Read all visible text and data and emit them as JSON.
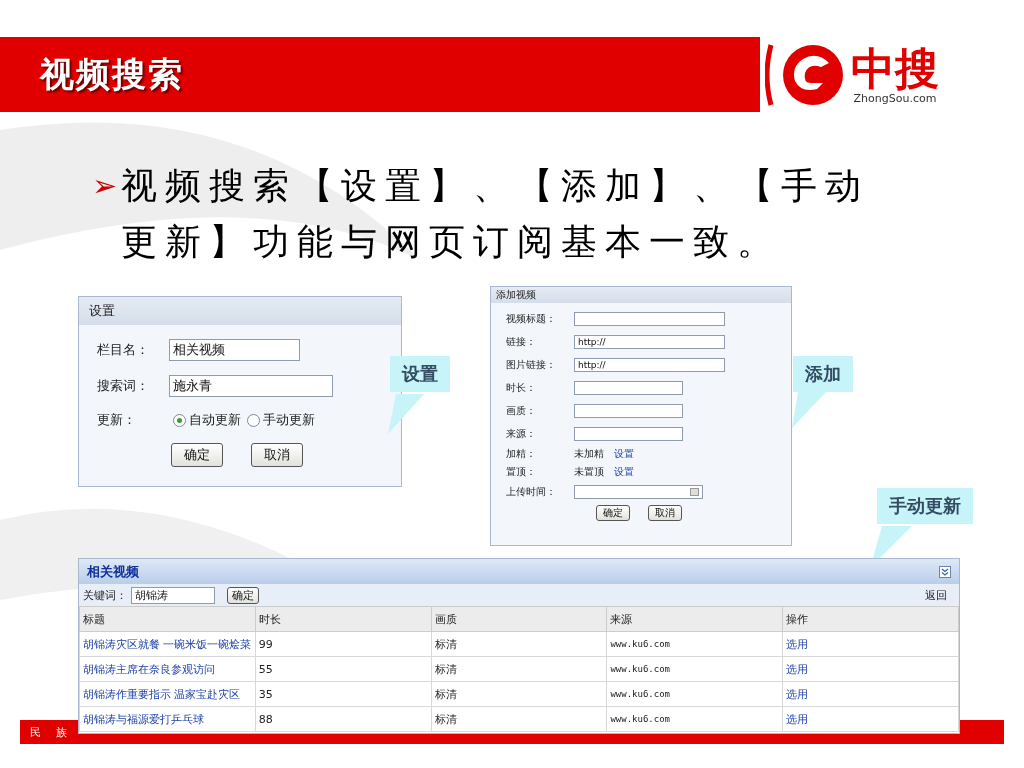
{
  "header": {
    "title": "视频搜索"
  },
  "logo": {
    "name": "中搜",
    "domain": "ZhongSou.com"
  },
  "bullet": {
    "marker": "➢",
    "text": "视频搜索【设置】、【添加】、【手动更新】功能与网页订阅基本一致。"
  },
  "settings_panel": {
    "title": "设置",
    "fields": [
      {
        "label": "栏目名：",
        "value": "相关视频",
        "kind": "short"
      },
      {
        "label": "搜索词：",
        "value": "施永青",
        "kind": "long"
      }
    ],
    "update": {
      "label": "更新：",
      "options": [
        {
          "label": "自动更新",
          "selected": true
        },
        {
          "label": "手动更新",
          "selected": false
        }
      ]
    },
    "buttons": [
      "确定",
      "取消"
    ]
  },
  "add_panel": {
    "title": "添加视频",
    "rows": [
      {
        "kind": "wide",
        "label": "视频标题："
      },
      {
        "kind": "wide",
        "label": "链接：",
        "value": "http://"
      },
      {
        "kind": "wide",
        "label": "图片链接：",
        "value": "http://"
      },
      {
        "kind": "short",
        "label": "时长："
      },
      {
        "kind": "short",
        "label": "画质："
      },
      {
        "kind": "short",
        "label": "来源："
      },
      {
        "kind": "status",
        "label": "加精：",
        "status": "未加精",
        "link": "设置"
      },
      {
        "kind": "status",
        "label": "置顶：",
        "status": "未置顶",
        "link": "设置"
      },
      {
        "kind": "date",
        "label": "上传时间："
      }
    ],
    "buttons": [
      "确定",
      "取消"
    ]
  },
  "callouts": [
    {
      "text": "设置"
    },
    {
      "text": "添加"
    },
    {
      "text": "手动更新"
    }
  ],
  "video_panel": {
    "title": "相关视频",
    "keyword_label": "关键词：",
    "keyword_value": "胡锦涛",
    "confirm": "确定",
    "back": "返回",
    "columns": [
      "标题",
      "时长",
      "画质",
      "来源",
      "操作"
    ],
    "rows": [
      [
        "胡锦涛灾区就餐 一碗米饭一碗烩菜",
        "99",
        "标清",
        "www.ku6.com",
        "选用"
      ],
      [
        "胡锦涛主席在奈良参观访问",
        "55",
        "标清",
        "www.ku6.com",
        "选用"
      ],
      [
        "胡锦涛作重要指示 温家宝赴灾区",
        "35",
        "标清",
        "www.ku6.com",
        "选用"
      ],
      [
        "胡锦涛与福源爱打乒乓球",
        "88",
        "标清",
        "www.ku6.com",
        "选用"
      ]
    ]
  },
  "footer": {
    "text": "民 族"
  }
}
